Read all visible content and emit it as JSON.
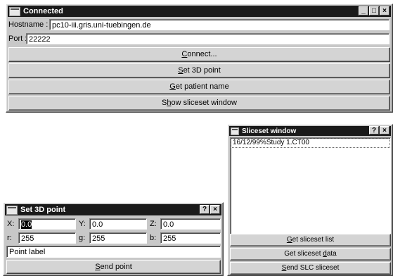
{
  "connected_window": {
    "title": "Connected",
    "window_buttons": [
      "_",
      "□",
      "×"
    ],
    "hostname_label": "Hostname :",
    "hostname_value": "pc10-iii.gris.uni-tuebingen.de",
    "port_label": "Port :",
    "port_value": "22222",
    "buttons": {
      "connect": {
        "mnemonic": "C",
        "rest": "onnect..."
      },
      "set3d": {
        "mnemonic": "S",
        "rest": "et 3D point"
      },
      "patient": {
        "mnemonic": "G",
        "rest": "et patient name"
      },
      "showslice_pre": "S",
      "showslice": {
        "mnemonic": "h",
        "rest": "ow sliceset window"
      }
    }
  },
  "sliceset_window": {
    "title": "Sliceset window",
    "window_buttons": [
      "?",
      "×"
    ],
    "list_items": [
      "16/12/99%Study 1.CT00"
    ],
    "buttons": {
      "get_list": {
        "mnemonic": "G",
        "rest": "et sliceset list"
      },
      "get_data_pre": "Get sliceset ",
      "get_data": {
        "mnemonic": "d",
        "rest": "ata"
      },
      "send_slc": {
        "mnemonic": "S",
        "rest": "end SLC sliceset"
      }
    }
  },
  "set3d_window": {
    "title": "Set 3D point",
    "window_buttons": [
      "?",
      "×"
    ],
    "x_label": "X:",
    "x_value": "0.0",
    "y_label": "Y:",
    "y_value": "0.0",
    "z_label": "Z:",
    "z_value": "0.0",
    "r_label": "r:",
    "r_value": "255",
    "g_label": "g:",
    "g_value": "255",
    "b_label": "b:",
    "b_value": "255",
    "point_label_value": "Point label",
    "send_button": {
      "mnemonic": "S",
      "rest": "end point"
    }
  }
}
